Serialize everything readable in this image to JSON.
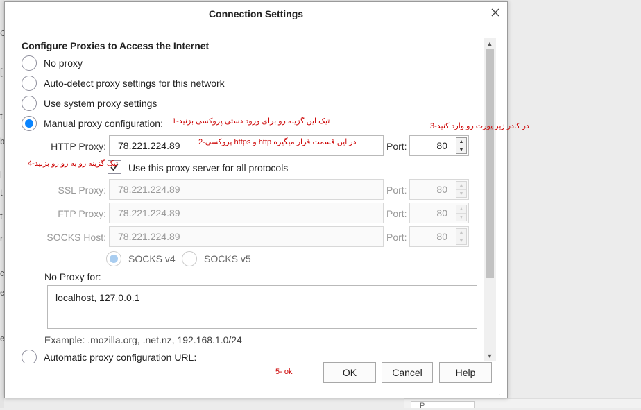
{
  "background": {
    "left_glyphs": [
      "C",
      "[",
      "t",
      "b",
      "l",
      "t",
      "t",
      "r",
      "c",
      "e",
      "e"
    ],
    "panel_label": "P"
  },
  "dialog": {
    "title": "Connection Settings",
    "heading": "Configure Proxies to Access the Internet",
    "options": {
      "no_proxy": "No proxy",
      "auto_detect": "Auto-detect proxy settings for this network",
      "system": "Use system proxy settings",
      "manual": "Manual proxy configuration:",
      "auto_url": "Automatic proxy configuration URL:"
    },
    "selected_option": "manual",
    "http": {
      "label": "HTTP Proxy:",
      "value": "78.221.224.89",
      "port_label": "Port:",
      "port": "80"
    },
    "use_all_protocols": {
      "label": "Use this proxy server for all protocols",
      "checked": true
    },
    "ssl": {
      "label": "SSL Proxy:",
      "value": "78.221.224.89",
      "port_label": "Port:",
      "port": "80"
    },
    "ftp": {
      "label": "FTP Proxy:",
      "value": "78.221.224.89",
      "port_label": "Port:",
      "port": "80"
    },
    "socks": {
      "label": "SOCKS Host:",
      "value": "78.221.224.89",
      "port_label": "Port:",
      "port": "80"
    },
    "socks_versions": {
      "v4": "SOCKS v4",
      "v5": "SOCKS v5",
      "selected": "v4"
    },
    "no_proxy_for": {
      "label": "No Proxy for:",
      "value": "localhost, 127.0.0.1"
    },
    "example": "Example: .mozilla.org, .net.nz, 192.168.1.0/24",
    "buttons": {
      "ok": "OK",
      "cancel": "Cancel",
      "help": "Help"
    }
  },
  "annotations": {
    "a1": "تیک این گزینه رو برای ورود دستی پروکسی بزنید-1",
    "a2": "در این قسمت قرار میگیره http و https پروکسی-2",
    "a3": "در کادر زیر پورت رو وارد کنید-3",
    "a4": "تیک گزینه رو به رو رو بزنید-4",
    "a5": "5- ok"
  },
  "colors": {
    "accent": "#0a84ff",
    "annotation": "#cc0000"
  }
}
